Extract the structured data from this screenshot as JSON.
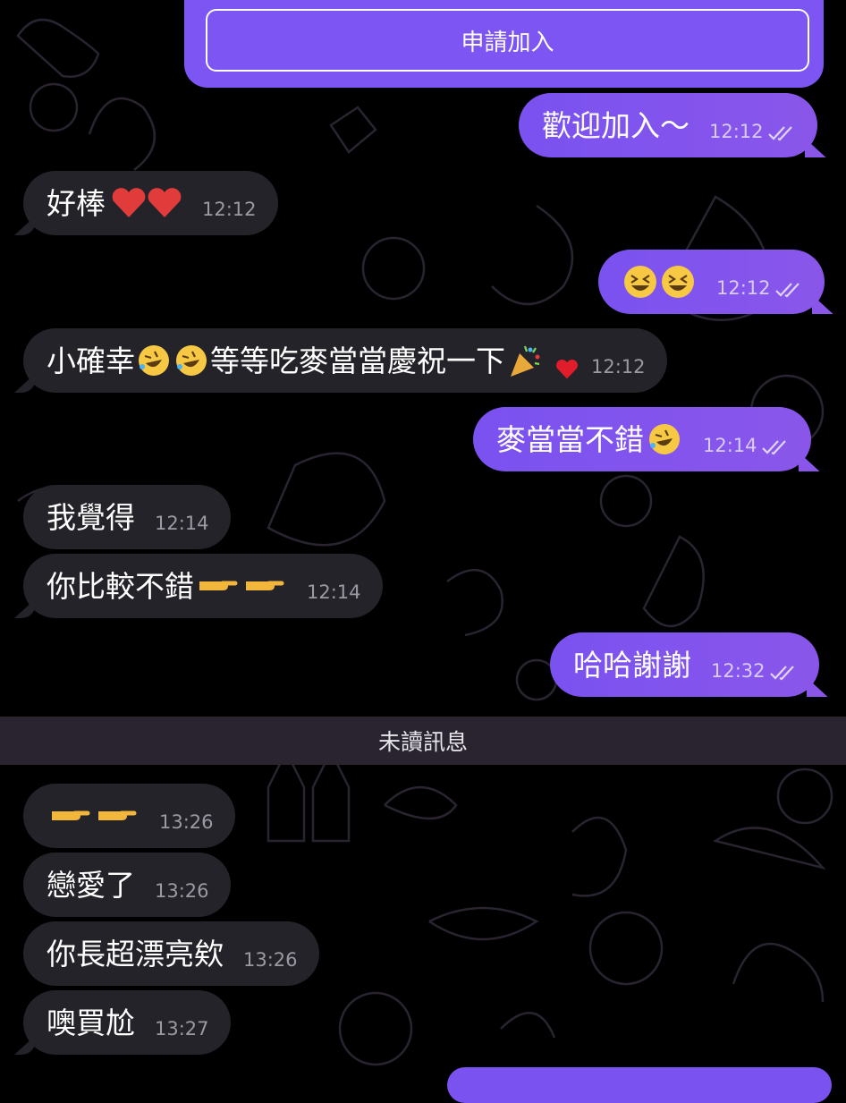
{
  "join": {
    "button_label": "申請加入"
  },
  "unread_label": "未讀訊息",
  "messages": [
    {
      "text": "歡迎加入～",
      "time": "12:12"
    },
    {
      "text": "好棒",
      "time": "12:12"
    },
    {
      "text": "",
      "time": "12:12"
    },
    {
      "text_a": "小確幸",
      "text_b": "等等吃麥當當慶祝一下",
      "time": "12:12"
    },
    {
      "text": "麥當當不錯",
      "time": "12:14"
    },
    {
      "text": "我覺得",
      "time": "12:14"
    },
    {
      "text": "你比較不錯",
      "time": "12:14"
    },
    {
      "text": "哈哈謝謝",
      "time": "12:32"
    },
    {
      "text": "",
      "time": "13:26"
    },
    {
      "text": "戀愛了",
      "time": "13:26"
    },
    {
      "text": "你長超漂亮欸",
      "time": "13:26"
    },
    {
      "text": "噢買尬",
      "time": "13:27"
    }
  ],
  "colors": {
    "outgoing": "#7a52f0",
    "incoming": "#242329",
    "background": "#000000",
    "unread_bar": "#2a2430"
  },
  "icons": [
    "heart-emoji",
    "grinning-squint-emoji",
    "rofl-emoji",
    "party-popper-emoji",
    "pointing-right-emoji",
    "double-check-icon"
  ]
}
